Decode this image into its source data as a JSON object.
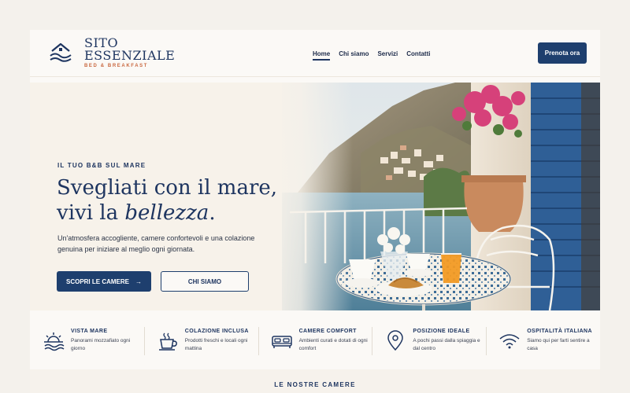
{
  "brand": {
    "line1": "SITO",
    "line2": "ESSENZIALE",
    "tagline": "BED & BREAKFAST"
  },
  "nav": {
    "items": [
      {
        "label": "Home",
        "active": true
      },
      {
        "label": "Chi siamo",
        "active": false
      },
      {
        "label": "Servizi",
        "active": false
      },
      {
        "label": "Contatti",
        "active": false
      }
    ]
  },
  "header": {
    "cta_label": "Prenota ora"
  },
  "hero": {
    "eyebrow": "IL TUO B&B SUL MARE",
    "title_line1": "Svegliati con il mare,",
    "title_line2_prefix": "vivi la ",
    "title_line2_italic": "bellezza",
    "title_line2_suffix": ".",
    "lead": "Un'atmosfera accogliente, camere confortevoli e una colazione genuina per iniziare al meglio ogni giornata.",
    "primary_label": "SCOPRI LE CAMERE",
    "primary_arrow": "→",
    "secondary_label": "CHI SIAMO"
  },
  "features": [
    {
      "icon": "sunset-sea-icon",
      "title": "VISTA MARE",
      "text": "Panorami mozzafiato ogni giorno"
    },
    {
      "icon": "coffee-cup-icon",
      "title": "COLAZIONE INCLUSA",
      "text": "Prodotti freschi e locali ogni mattina"
    },
    {
      "icon": "bed-icon",
      "title": "CAMERE COMFORT",
      "text": "Ambienti curati e dotati di ogni comfort"
    },
    {
      "icon": "location-pin-icon",
      "title": "POSIZIONE IDEALE",
      "text": "A pochi passi dalla spiaggia e dal centro"
    },
    {
      "icon": "wifi-icon",
      "title": "OSPITALITÀ ITALIANA",
      "text": "Siamo qui per farti sentire a casa"
    }
  ],
  "rooms_section": {
    "title": "LE NOSTRE CAMERE"
  },
  "colors": {
    "navy": "#1e3560",
    "button": "#1e3f6e",
    "accent": "#c9673f",
    "background": "#f7f2ea"
  }
}
